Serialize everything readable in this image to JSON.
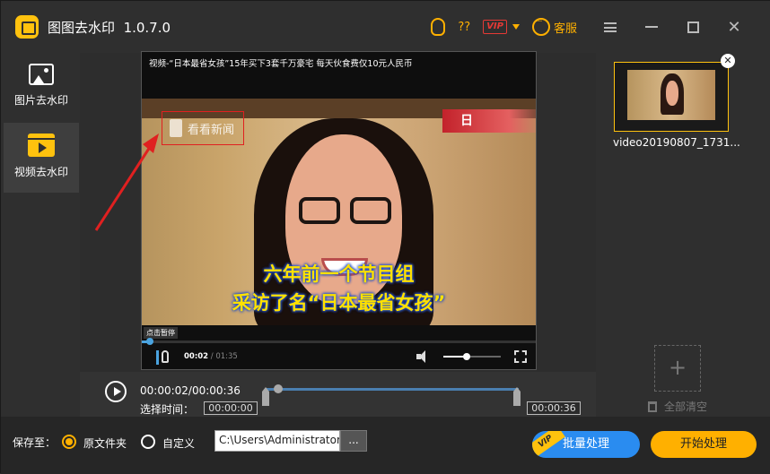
{
  "titlebar": {
    "app_name": "图图去水印",
    "version": "1.0.7.0",
    "help_label": "??",
    "vip_label": "VIP",
    "service_label": "客服"
  },
  "sidebar": {
    "items": [
      {
        "label": "图片去水印",
        "icon": "image-icon",
        "active": false
      },
      {
        "label": "视频去水印",
        "icon": "video-icon",
        "active": true
      }
    ]
  },
  "video": {
    "title": "视频-“日本最省女孩”15年买下3套千万豪宅 每天伙食费仅10元人民币",
    "watermark_text": "看看新闻",
    "tag_text": "日",
    "caption_line1": "六年前一个节目组",
    "caption_line2": "采访了名“日本最省女孩”",
    "pause_tip": "点击暂停",
    "current_time": "00:02",
    "total_time": "/ 01:35",
    "progress": 0.02,
    "volume": 0.4
  },
  "timeline": {
    "time_display": "00:00:02/00:00:36",
    "select_label": "选择时间：",
    "start_value": "00:00:00",
    "end_value": "00:00:36"
  },
  "file_list": {
    "files": [
      {
        "name": "video20190807_1731...",
        "selected": true
      }
    ],
    "add_symbol": "+",
    "clear_label": "全部清空"
  },
  "bottom": {
    "save_to_label": "保存至：",
    "options": [
      {
        "label": "原文件夹",
        "selected": true
      },
      {
        "label": "自定义",
        "selected": false
      }
    ],
    "path_value": "C:\\Users\\Administrator",
    "browse_label": "...",
    "batch_label": "批量处理",
    "batch_badge": "VIP",
    "start_label": "开始处理"
  },
  "colors": {
    "accent": "#ffb000",
    "primary_blue": "#2a8cf0",
    "highlight_red": "#e02020",
    "background": "#2d2d2d"
  }
}
